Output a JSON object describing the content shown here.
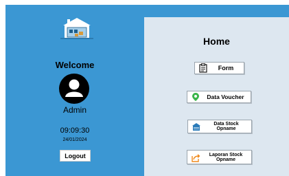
{
  "sidebar": {
    "welcome": "Welcome",
    "username": "Admin",
    "time": "09:09:30",
    "date": "24/01/2024",
    "logout_label": "Logout"
  },
  "main": {
    "title": "Home",
    "menu": [
      {
        "label": "Form",
        "icon": "clipboard-icon"
      },
      {
        "label": "Data Voucher",
        "icon": "voucher-icon"
      },
      {
        "label": "Data Stock\nOpname",
        "icon": "warehouse-icon"
      },
      {
        "label": "Laporan Stock\nOpname",
        "icon": "share-icon"
      }
    ]
  },
  "colors": {
    "sidebar_bg": "#3b97d3",
    "main_bg": "#dde7f0",
    "voucher_green": "#3ab54a",
    "laporan_orange": "#f18a1c"
  }
}
